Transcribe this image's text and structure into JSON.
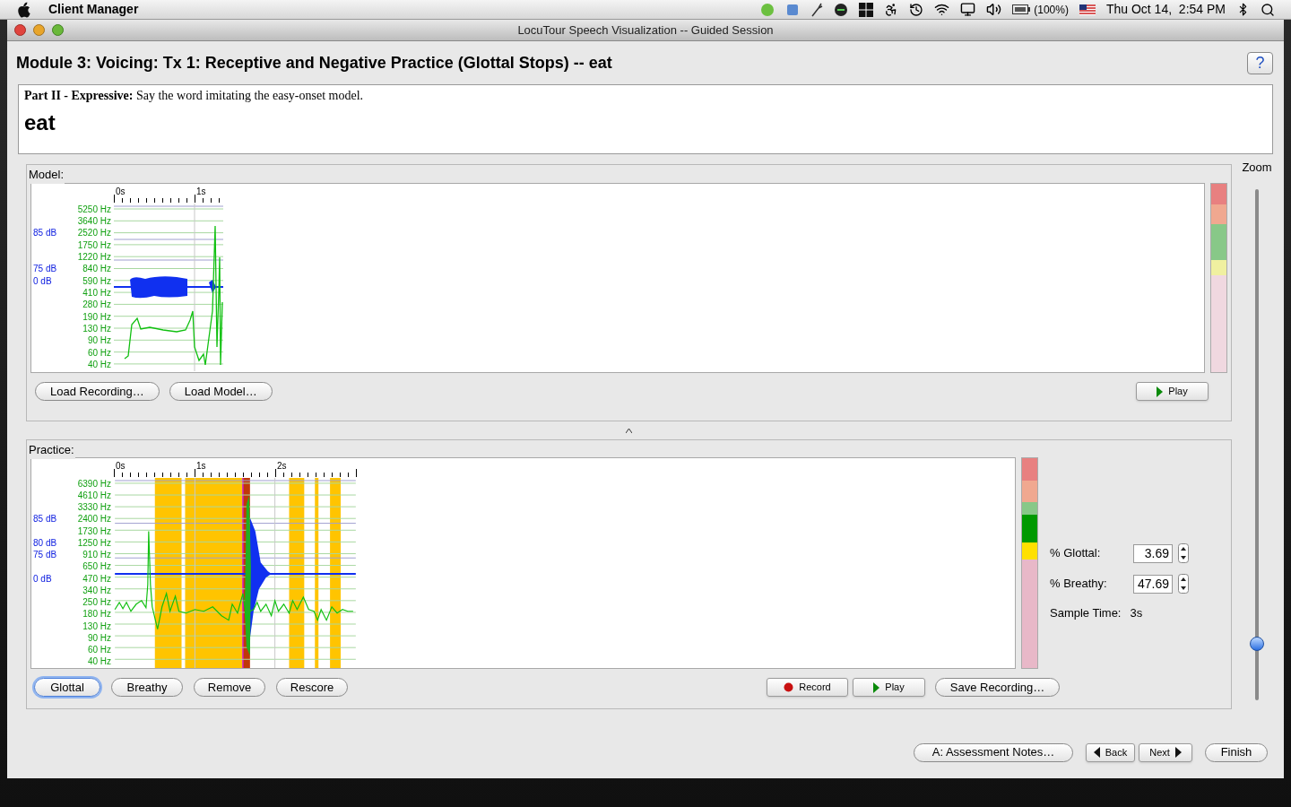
{
  "menubar": {
    "app": "Client Manager",
    "battery": "(100%)",
    "clock": "Thu Oct 14,  2:54 PM"
  },
  "window": {
    "title": "LocuTour Speech Visualization -- Guided Session"
  },
  "heading": "Module 3: Voicing: Tx 1: Receptive and Negative Practice (Glottal Stops) -- eat",
  "help": "?",
  "prompt": {
    "instruction": "**Part II - Expressive:** Say the word imitating the easy-onset model.",
    "word": "eat"
  },
  "model": {
    "legend": "Model:",
    "time_labels": [
      "0s",
      "1s"
    ],
    "rows": [
      {
        "hz": "5250 Hz"
      },
      {
        "hz": "3640 Hz"
      },
      {
        "db": "85 dB",
        "hz": "2520 Hz"
      },
      {
        "hz": "1750 Hz"
      },
      {
        "hz": "1220 Hz"
      },
      {
        "db": "75 dB",
        "hz": "840 Hz"
      },
      {
        "db": "0 dB",
        "hz": "590 Hz"
      },
      {
        "hz": "410 Hz"
      },
      {
        "hz": "280 Hz"
      },
      {
        "hz": "190 Hz"
      },
      {
        "hz": "130 Hz"
      },
      {
        "hz": "90 Hz"
      },
      {
        "hz": "60 Hz"
      },
      {
        "hz": "40 Hz"
      }
    ],
    "meter": [
      {
        "color": "#e88080"
      },
      {
        "color": "#f0a890"
      },
      {
        "color": "#88c888"
      },
      {
        "color": "#f0f0a0"
      },
      {
        "color": "#f0d8e0"
      }
    ],
    "buttons": [
      {
        "label": "Load Recording…"
      },
      {
        "label": "Load Model…"
      }
    ],
    "play": "Play"
  },
  "practice": {
    "legend": "Practice:",
    "time_labels": [
      "0s",
      "1s",
      "2s"
    ],
    "rows": [
      {
        "hz": "6390 Hz"
      },
      {
        "hz": "4610 Hz"
      },
      {
        "hz": "3330 Hz"
      },
      {
        "db": "85 dB",
        "hz": "2400 Hz"
      },
      {
        "hz": "1730 Hz"
      },
      {
        "db": "80 dB",
        "hz": "1250 Hz"
      },
      {
        "db": "75 dB",
        "hz": "910 Hz"
      },
      {
        "hz": "650 Hz"
      },
      {
        "db": "0 dB",
        "hz": "470 Hz"
      },
      {
        "hz": "340 Hz"
      },
      {
        "hz": "250 Hz"
      },
      {
        "hz": "180 Hz"
      },
      {
        "hz": "130 Hz"
      },
      {
        "hz": "90 Hz"
      },
      {
        "hz": "60 Hz"
      },
      {
        "hz": "40 Hz"
      }
    ],
    "meter": [
      {
        "color": "#e88080"
      },
      {
        "color": "#f0a890"
      },
      {
        "color": "#88c888"
      },
      {
        "color": "#009900"
      },
      {
        "color": "#ffe000"
      },
      {
        "color": "#e8b8c8"
      }
    ],
    "score_buttons": [
      {
        "label": "Glottal",
        "selected": true
      },
      {
        "label": "Breathy",
        "selected": false
      },
      {
        "label": "Remove",
        "selected": false
      },
      {
        "label": "Rescore",
        "selected": false
      }
    ],
    "record": "Record",
    "play": "Play",
    "save": "Save Recording…",
    "fields": [
      {
        "label": "% Glottal:",
        "value": "3.69"
      },
      {
        "label": "% Breathy:",
        "value": "47.69"
      }
    ],
    "sample_time": {
      "label": "Sample Time:",
      "value": "3s"
    }
  },
  "zoom": {
    "label": "Zoom",
    "level": 0.11
  },
  "footer": {
    "notes": "A: Assessment Notes…",
    "back": "Back",
    "next": "Next",
    "finish": "Finish"
  }
}
